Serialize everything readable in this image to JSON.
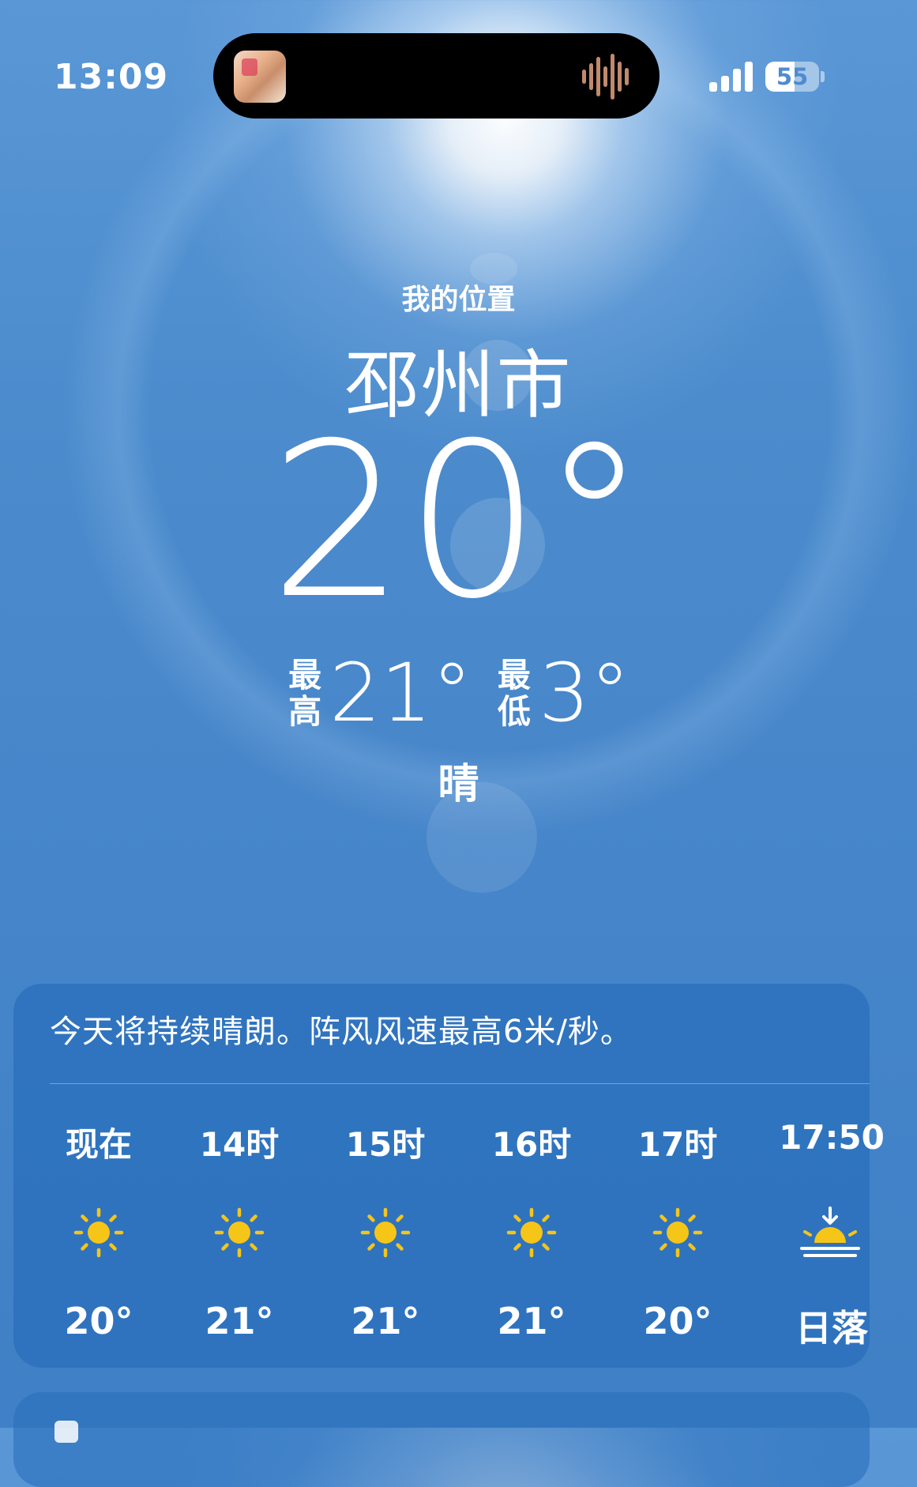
{
  "status_bar": {
    "time": "13:09",
    "battery": "55",
    "battery_percent": 55
  },
  "location": {
    "label": "我的位置",
    "city": "邳州市"
  },
  "current": {
    "temp": "20°",
    "high_label": "最高",
    "high": "21°",
    "low_label": "最低",
    "low": "3°",
    "condition": "晴"
  },
  "forecast_card": {
    "summary": "今天将持续晴朗。阵风风速最高6米/秒。",
    "hours": [
      {
        "label": "现在",
        "icon": "sun-icon",
        "temp": "20°"
      },
      {
        "label": "14时",
        "icon": "sun-icon",
        "temp": "21°"
      },
      {
        "label": "15时",
        "icon": "sun-icon",
        "temp": "21°"
      },
      {
        "label": "16时",
        "icon": "sun-icon",
        "temp": "21°"
      },
      {
        "label": "17时",
        "icon": "sun-icon",
        "temp": "20°"
      },
      {
        "label": "17:50",
        "icon": "sunset-icon",
        "temp": "日落"
      }
    ]
  },
  "colors": {
    "sun": "#f5c518",
    "card": "#2a70bc",
    "sky": "#4c8ccd"
  }
}
